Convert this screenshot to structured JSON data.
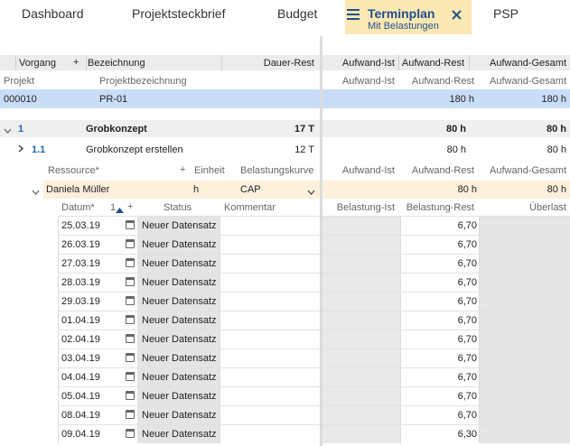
{
  "tabs": [
    {
      "label": "Dashboard"
    },
    {
      "label": "Projektsteckbrief"
    },
    {
      "label": "Budget"
    },
    {
      "label": "Terminplan",
      "sublabel": "Mit Belastungen",
      "active": true
    },
    {
      "label": "PSP"
    }
  ],
  "header": {
    "vorgang": "Vorgang",
    "plus": "+",
    "bezeichnung": "Bezeichnung",
    "dauer_rest": "Dauer-Rest",
    "aufwand_ist": "Aufwand-Ist",
    "aufwand_rest": "Aufwand-Rest",
    "aufwand_gesamt": "Aufwand-Gesamt"
  },
  "subheader": {
    "projekt": "Projekt",
    "projektbezeichnung": "Projektbezeichnung",
    "aufwand_ist": "Aufwand-Ist",
    "aufwand_rest": "Aufwand-Rest",
    "aufwand_gesamt": "Aufwand-Gesamt"
  },
  "project_row": {
    "id": "000010",
    "name": "PR-01",
    "aufwand_rest": "180 h",
    "aufwand_gesamt": "180 h"
  },
  "group_row": {
    "id": "1",
    "name": "Grobkonzept",
    "dauer": "17 T",
    "aufwand_rest": "80 h",
    "aufwand_gesamt": "80 h"
  },
  "task_row": {
    "id": "1.1",
    "name": "Grobkonzept erstellen",
    "dauer": "12 T",
    "aufwand_rest": "80 h",
    "aufwand_gesamt": "80 h"
  },
  "resource_header": {
    "ressource": "Ressource*",
    "plus": "+",
    "einheit": "Einheit",
    "belastungskurve": "Belastungskurve",
    "aufwand_ist": "Aufwand-Ist",
    "aufwand_rest": "Aufwand-Rest",
    "aufwand_gesamt": "Aufwand-Gesamt"
  },
  "resource_row": {
    "name": "Daniela Müller",
    "einheit": "h",
    "kurve": "CAP",
    "aufwand_rest": "80 h",
    "aufwand_gesamt": "80 h"
  },
  "date_header": {
    "datum": "Datum*",
    "sort": "1",
    "plus": "+",
    "status": "Status",
    "kommentar": "Kommentar",
    "belastung_ist": "Belastung-Ist",
    "belastung_rest": "Belastung-Rest",
    "ueberlast": "Überlast"
  },
  "date_rows": [
    {
      "datum": "25.03.19",
      "status": "Neuer Datensatz",
      "rest": "6,70"
    },
    {
      "datum": "26.03.19",
      "status": "Neuer Datensatz",
      "rest": "6,70"
    },
    {
      "datum": "27.03.19",
      "status": "Neuer Datensatz",
      "rest": "6,70"
    },
    {
      "datum": "28.03.19",
      "status": "Neuer Datensatz",
      "rest": "6,70"
    },
    {
      "datum": "29.03.19",
      "status": "Neuer Datensatz",
      "rest": "6,70"
    },
    {
      "datum": "01.04.19",
      "status": "Neuer Datensatz",
      "rest": "6,70"
    },
    {
      "datum": "02.04.19",
      "status": "Neuer Datensatz",
      "rest": "6,70"
    },
    {
      "datum": "03.04.19",
      "status": "Neuer Datensatz",
      "rest": "6,70"
    },
    {
      "datum": "04.04.19",
      "status": "Neuer Datensatz",
      "rest": "6,70"
    },
    {
      "datum": "05.04.19",
      "status": "Neuer Datensatz",
      "rest": "6,70"
    },
    {
      "datum": "08.04.19",
      "status": "Neuer Datensatz",
      "rest": "6,70"
    },
    {
      "datum": "09.04.19",
      "status": "Neuer Datensatz",
      "rest": "6,30"
    }
  ],
  "colors": {
    "accent": "#1e4f8e",
    "active_tab": "#fce8b2",
    "selected_row": "#c9ddf7",
    "resource_row": "#fdf1dc"
  }
}
